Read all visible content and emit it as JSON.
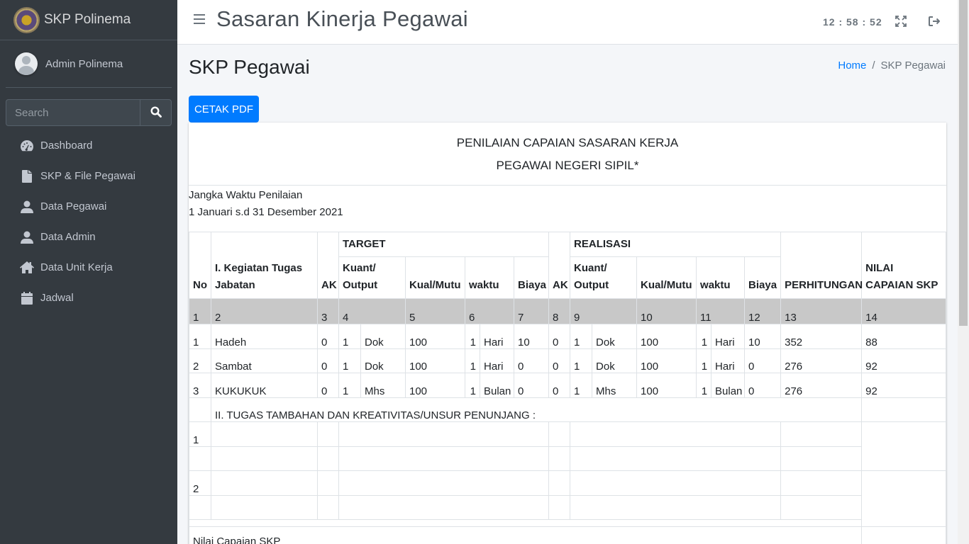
{
  "brand": {
    "name": "SKP Polinema"
  },
  "user": {
    "name": "Admin Polinema"
  },
  "search": {
    "placeholder": "Search"
  },
  "sidebar": {
    "items": [
      {
        "label": "Dashboard",
        "icon": "tachometer-icon"
      },
      {
        "label": "SKP & File Pegawai",
        "icon": "file-icon"
      },
      {
        "label": "Data Pegawai",
        "icon": "user-icon"
      },
      {
        "label": "Data Admin",
        "icon": "user-icon"
      },
      {
        "label": "Data Unit Kerja",
        "icon": "home-icon"
      },
      {
        "label": "Jadwal",
        "icon": "calendar-icon"
      }
    ]
  },
  "header": {
    "title": "Sasaran Kinerja Pegawai",
    "clock": "12 : 58 : 52"
  },
  "page": {
    "title": "SKP Pegawai",
    "breadcrumb": {
      "home": "Home",
      "separator": "/",
      "current": "SKP Pegawai"
    },
    "print_button": "CETAK PDF"
  },
  "document": {
    "heading_line1": "PENILAIAN CAPAIAN SASARAN KERJA",
    "heading_line2": "PEGAWAI NEGERI SIPIL*",
    "period_label": "Jangka Waktu Penilaian",
    "period_value": "1 Januari s.d 31 Desember 2021"
  },
  "table": {
    "headers": {
      "no": "No",
      "kegiatan": "I. Kegiatan Tugas Jabatan",
      "ak": "AK",
      "target": "TARGET",
      "realisasi": "REALISASI",
      "kuant_output": "Kuant/ Output",
      "kual_mutu": "Kual/Mutu",
      "waktu": "waktu",
      "biaya": "Biaya",
      "perhitungan": "PERHITUNGAN",
      "nilai_capaian": "NILAI CAPAIAN SKP"
    },
    "column_numbers": [
      "1",
      "2",
      "3",
      "4",
      "5",
      "6",
      "7",
      "8",
      "9",
      "10",
      "11",
      "12",
      "13",
      "14"
    ],
    "rows": [
      {
        "no": "1",
        "kegiatan": "Hadeh",
        "ak": "0",
        "t_kuant": "1",
        "t_unit": "Dok",
        "t_kual": "100",
        "t_waktu": "1",
        "t_waktu_unit": "Hari",
        "t_biaya": "10",
        "r_ak": "0",
        "r_kuant": "1",
        "r_unit": "Dok",
        "r_kual": "100",
        "r_waktu": "1",
        "r_waktu_unit": "Hari",
        "r_biaya": "10",
        "perhitungan": "352",
        "nilai": "88"
      },
      {
        "no": "2",
        "kegiatan": "Sambat",
        "ak": "0",
        "t_kuant": "1",
        "t_unit": "Dok",
        "t_kual": "100",
        "t_waktu": "1",
        "t_waktu_unit": "Hari",
        "t_biaya": "0",
        "r_ak": "0",
        "r_kuant": "1",
        "r_unit": "Dok",
        "r_kual": "100",
        "r_waktu": "1",
        "r_waktu_unit": "Hari",
        "r_biaya": "0",
        "perhitungan": "276",
        "nilai": "92"
      },
      {
        "no": "3",
        "kegiatan": "KUKUKUK",
        "ak": "0",
        "t_kuant": "1",
        "t_unit": "Mhs",
        "t_kual": "100",
        "t_waktu": "1",
        "t_waktu_unit": "Bulan",
        "t_biaya": "0",
        "r_ak": "0",
        "r_kuant": "1",
        "r_unit": "Mhs",
        "r_kual": "100",
        "r_waktu": "1",
        "r_waktu_unit": "Bulan",
        "r_biaya": "0",
        "perhitungan": "276",
        "nilai": "92"
      }
    ],
    "section2_title": "II. TUGAS TAMBAHAN DAN KREATIVITAS/UNSUR PENUNJANG :",
    "section2_rows": [
      "1",
      "2"
    ],
    "nilai_label": "Nilai Capaian SKP"
  }
}
